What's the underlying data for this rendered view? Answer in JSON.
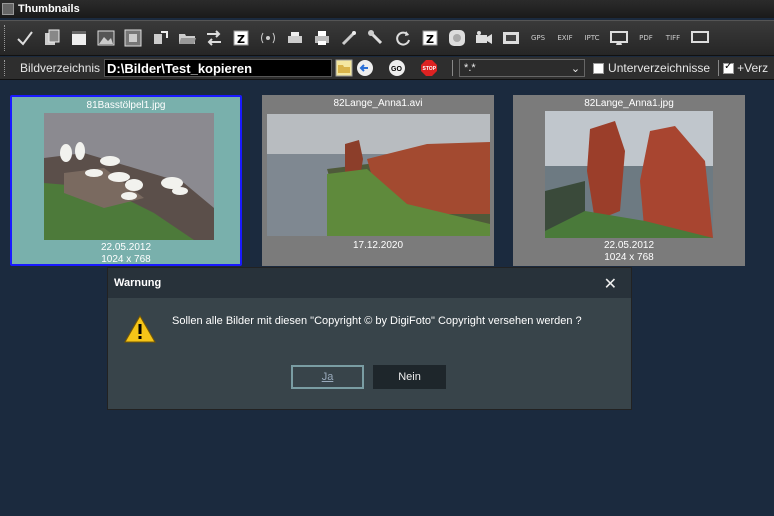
{
  "window": {
    "title": "Thumbnails"
  },
  "toolbar": {
    "icons": [
      "check-icon",
      "copy-icon",
      "window-icon",
      "image-icon",
      "filmstrip-icon",
      "export-icon",
      "folder-open-icon",
      "arrows-icon",
      "zip-icon",
      "radio-icon",
      "printer-icon",
      "printer2-icon",
      "magic-icon",
      "tools-icon",
      "refresh-icon",
      "zip2-icon",
      "circle-icon",
      "camera-icon",
      "film-icon",
      "gps-icon",
      "exif-icon",
      "iptc-icon",
      "screen-icon",
      "pdf-icon",
      "tiff-icon",
      "more-icon"
    ],
    "labels": {
      "gps": "GPS",
      "exif": "EXIF",
      "iptc": "IPTC",
      "pdf": "PDF",
      "tiff": "TIFF"
    }
  },
  "pathbar": {
    "label": "Bildverzeichnis",
    "path": "D:\\Bilder\\Test_kopieren",
    "mask": "*.*",
    "subdirs_label": "Unterverzeichnisse",
    "subdirs_checked": false,
    "extra_label": "+Verz",
    "extra_checked": true
  },
  "thumbnails": [
    {
      "name": "81Basstölpel1.jpg",
      "date": "22.05.2012",
      "size": "1024 x 768",
      "selected": true
    },
    {
      "name": "82Lange_Anna1.avi",
      "date": "17.12.2020",
      "size": "",
      "selected": false
    },
    {
      "name": "82Lange_Anna1.jpg",
      "date": "22.05.2012",
      "size": "1024 x 768",
      "selected": false
    }
  ],
  "dialog": {
    "title": "Warnung",
    "message": "Sollen alle Bilder mit diesen \"Copyright © by DigiFoto\" Copyright versehen werden ?",
    "yes": "Ja",
    "no": "Nein"
  }
}
